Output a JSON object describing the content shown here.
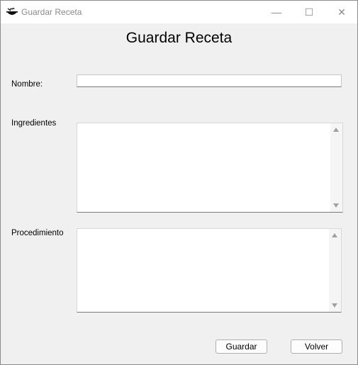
{
  "window": {
    "title": "Guardar Receta",
    "icon": "cooking-pot-icon",
    "controls": {
      "minimize": "—",
      "maximize": "☐",
      "close": "✕"
    }
  },
  "form": {
    "heading": "Guardar Receta",
    "fields": {
      "nombre": {
        "label": "Nombre:",
        "value": ""
      },
      "ingredientes": {
        "label": "Ingredientes",
        "value": ""
      },
      "procedimiento": {
        "label": "Procedimiento",
        "value": ""
      }
    },
    "buttons": {
      "save": "Guardar",
      "back": "Volver"
    }
  }
}
